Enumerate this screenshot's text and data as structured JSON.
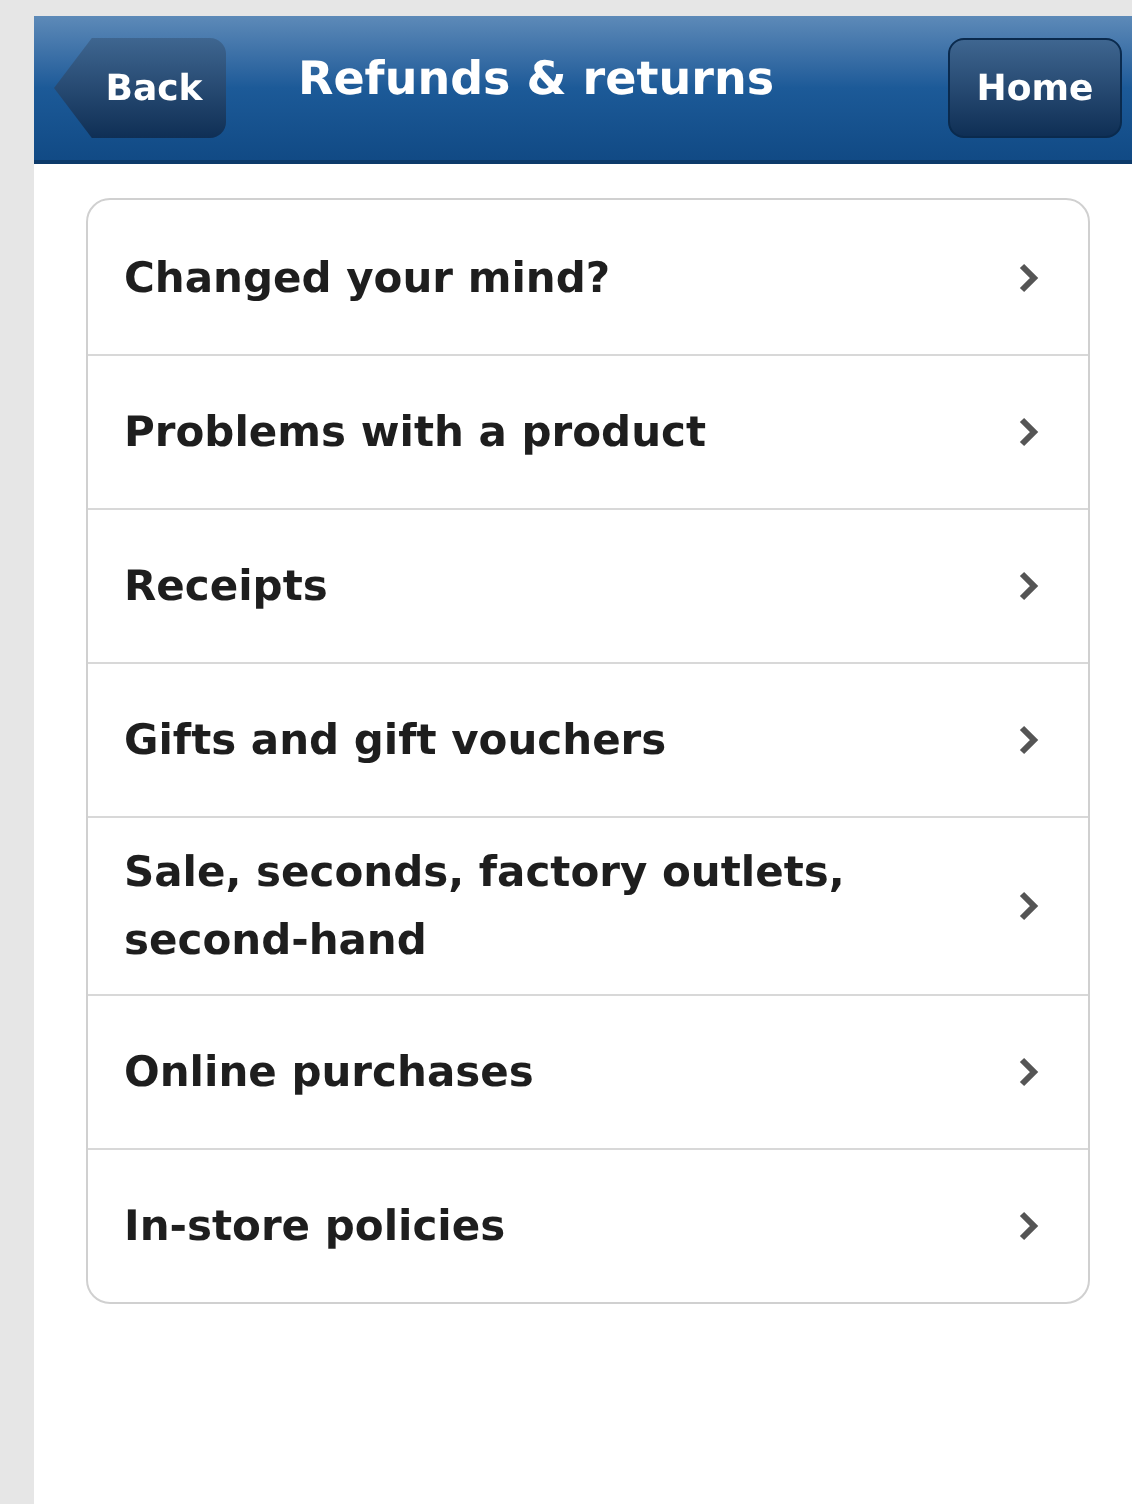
{
  "header": {
    "back_button": "Back",
    "title": "Refunds & returns",
    "home_button": "Home"
  },
  "items": [
    {
      "label": "Changed your mind?"
    },
    {
      "label": "Problems with a product"
    },
    {
      "label": "Receipts"
    },
    {
      "label": "Gifts and gift vouchers"
    },
    {
      "label": "Sale, seconds, factory outlets, second-hand"
    },
    {
      "label": "Online purchases"
    },
    {
      "label": "In-store policies"
    }
  ]
}
